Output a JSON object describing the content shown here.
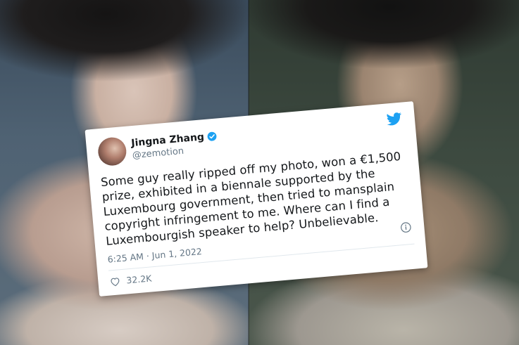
{
  "tweet": {
    "display_name": "Jingna Zhang",
    "handle": "@zemotion",
    "text": "Some guy really ripped off my photo, won a €1,500 prize, exhibited in a biennale supported by the Luxembourg government, then tried to mansplain copyright infringement to me. Where can I find a Luxembourgish speaker to help? Unbelievable.",
    "timestamp": "6:25 AM · Jun 1, 2022",
    "likes": "32.2K"
  },
  "icons": {
    "verified": "verified-badge-icon",
    "brand": "twitter-bird-icon",
    "info": "info-icon",
    "like": "heart-icon"
  },
  "colors": {
    "twitter_blue": "#1da1f2",
    "text_primary": "#14171a",
    "text_secondary": "#657786"
  }
}
